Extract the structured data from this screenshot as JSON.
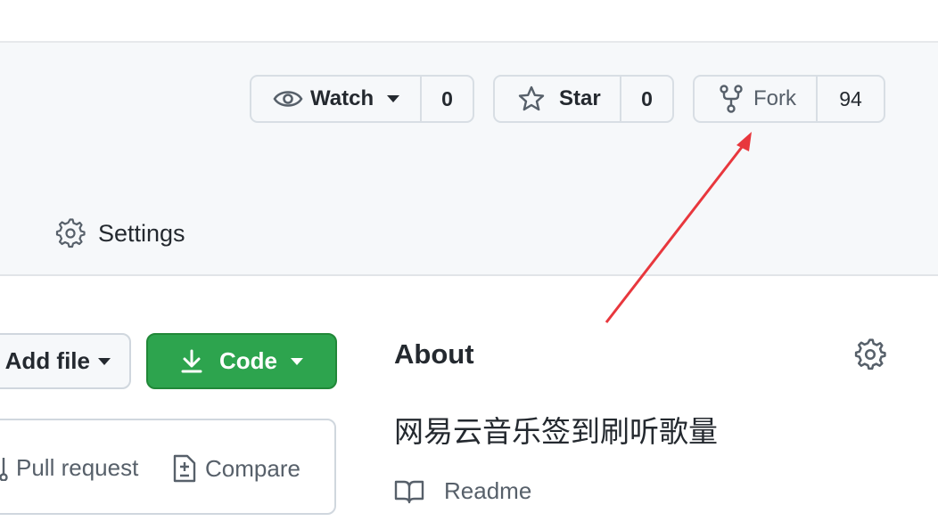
{
  "header": {
    "watch": {
      "label": "Watch",
      "count": "0",
      "icon": "eye-icon"
    },
    "star": {
      "label": "Star",
      "count": "0",
      "icon": "star-icon"
    },
    "fork": {
      "label": "Fork",
      "count": "94",
      "icon": "repo-forked-icon"
    }
  },
  "nav": {
    "settings_label": "Settings"
  },
  "actions": {
    "add_file_label": "Add file",
    "code_label": "Code",
    "pull_request_label": "Pull request",
    "compare_label": "Compare"
  },
  "about": {
    "title": "About",
    "description": "网易云音乐签到刷听歌量",
    "readme_label": "Readme"
  },
  "annotation": {
    "color": "#e8373d"
  },
  "colors": {
    "primary_green": "#2da44e",
    "muted_text": "#57606a",
    "border": "#d0d7de"
  }
}
